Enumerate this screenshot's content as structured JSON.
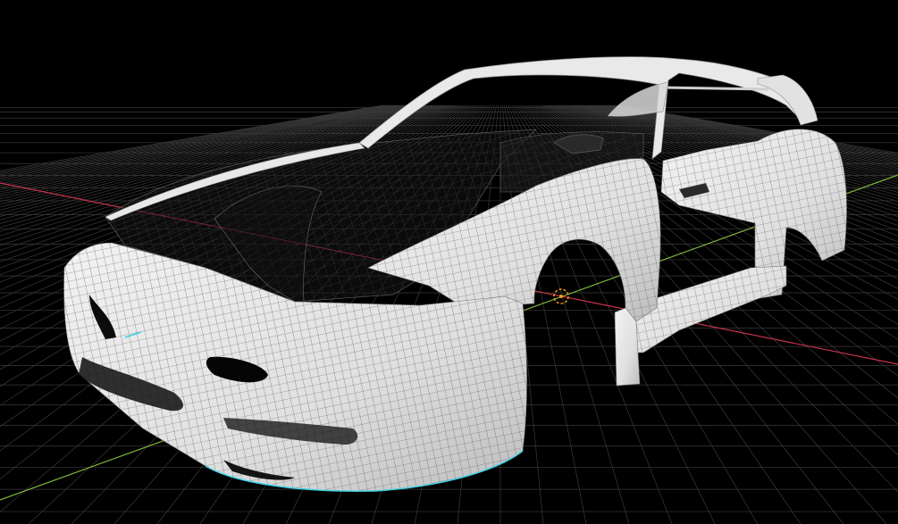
{
  "viewport": {
    "background_color": "#000000",
    "grid_color": "#3a3a3a",
    "x_axis_color": "#c8324a",
    "y_axis_color": "#7fb53a",
    "mesh_fill_color": "#e6e6e6",
    "wire_color": "#3c3c3c",
    "origin_marker_color": "#ff9a1a",
    "selection_outline_color": "#3fd1e6"
  },
  "object": {
    "name_icon": "car-body-mesh-icon",
    "mode": "wireframe-on-shaded"
  },
  "gizmos": {
    "origin_icon": "object-origin-icon",
    "cursor_icon": "3d-cursor-icon"
  }
}
